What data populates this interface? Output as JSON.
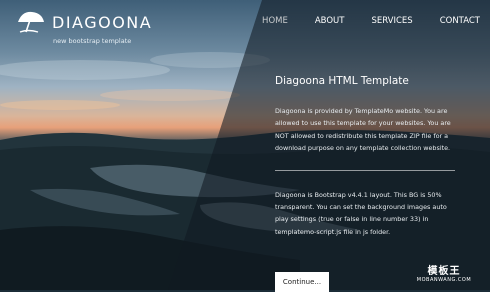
{
  "brand": {
    "title": "DIAGOONA",
    "subtitle": "new bootstrap template",
    "icon": "beach-umbrella-icon"
  },
  "nav": {
    "items": [
      {
        "label": "HOME",
        "active": true
      },
      {
        "label": "ABOUT"
      },
      {
        "label": "SERVICES"
      },
      {
        "label": "CONTACT"
      }
    ]
  },
  "content": {
    "heading": "Diagoona HTML Template",
    "para1": "Diagoona is provided by TemplateMo website. You are allowed to use this template for your websites. You are NOT allowed to redistribute this template ZIP file for a download purpose on any template collection website.",
    "para2": "Diagoona is Bootstrap v4.4.1 layout. This BG is 50% transparent. You can set the background images auto play settings (true or false in line number 33) in templatemo-script.js file in js folder.",
    "button": "Continue..."
  },
  "watermark": {
    "cn": "模板王",
    "en": "MOBANWANG.COM"
  }
}
